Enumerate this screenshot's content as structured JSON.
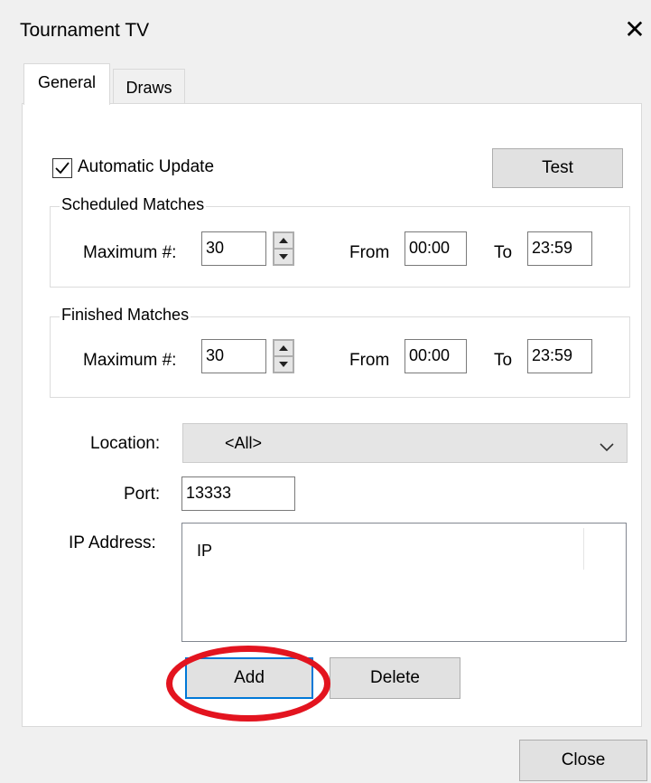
{
  "window": {
    "title": "Tournament TV"
  },
  "tabs": [
    {
      "label": "General"
    },
    {
      "label": "Draws"
    }
  ],
  "general": {
    "auto_update_label": "Automatic Update",
    "auto_update_checked": true,
    "test_button": "Test",
    "scheduled": {
      "legend": "Scheduled Matches",
      "max_label": "Maximum #:",
      "max_value": "30",
      "from_label": "From",
      "from_value": "00:00",
      "to_label": "To",
      "to_value": "23:59"
    },
    "finished": {
      "legend": "Finished Matches",
      "max_label": "Maximum #:",
      "max_value": "30",
      "from_label": "From",
      "from_value": "00:00",
      "to_label": "To",
      "to_value": "23:59"
    },
    "location_label": "Location:",
    "location_value": "<All>",
    "port_label": "Port:",
    "port_value": "13333",
    "ip_label": "IP Address:",
    "ip_list": {
      "column_header": "IP"
    },
    "add_button": "Add",
    "delete_button": "Delete"
  },
  "footer": {
    "close_button": "Close"
  },
  "annotation": {
    "color": "#e3141f"
  }
}
